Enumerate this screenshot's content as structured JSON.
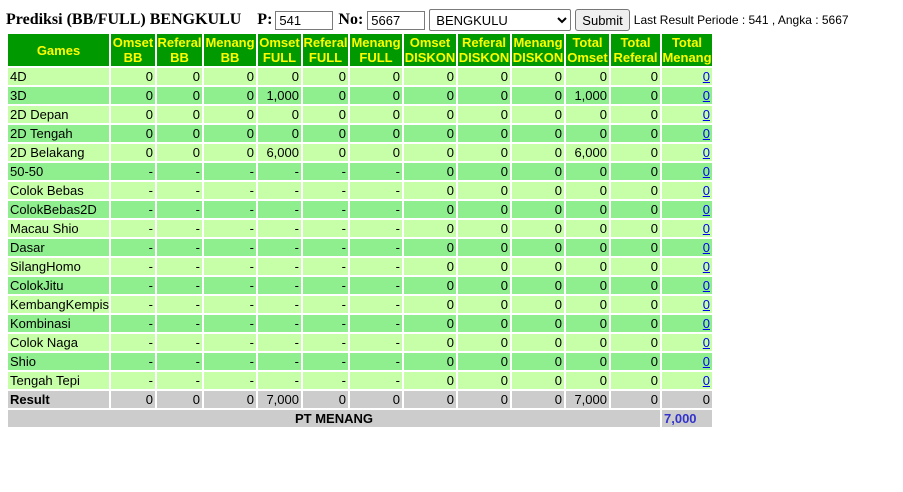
{
  "header": {
    "title": "Prediksi (BB/FULL) BENGKULU",
    "p_label": "P:",
    "p_value": "541",
    "no_label": "No:",
    "no_value": "5667",
    "market_selected": "BENGKULU",
    "submit_label": "Submit",
    "last_result": "Last Result Periode : 541 , Angka : 5667"
  },
  "table": {
    "headers": [
      [
        "Games"
      ],
      [
        "Omset",
        "BB"
      ],
      [
        "Referal",
        "BB"
      ],
      [
        "Menang",
        "BB"
      ],
      [
        "Omset",
        "FULL"
      ],
      [
        "Referal",
        "FULL"
      ],
      [
        "Menang",
        "FULL"
      ],
      [
        "Omset",
        "DISKON"
      ],
      [
        "Referal",
        "DISKON"
      ],
      [
        "Menang",
        "DISKON"
      ],
      [
        "Total",
        "Omset"
      ],
      [
        "Total",
        "Referal"
      ],
      [
        "Total",
        "Menang"
      ]
    ],
    "rows": [
      [
        "4D",
        "0",
        "0",
        "0",
        "0",
        "0",
        "0",
        "0",
        "0",
        "0",
        "0",
        "0",
        "0"
      ],
      [
        "3D",
        "0",
        "0",
        "0",
        "1,000",
        "0",
        "0",
        "0",
        "0",
        "0",
        "1,000",
        "0",
        "0"
      ],
      [
        "2D Depan",
        "0",
        "0",
        "0",
        "0",
        "0",
        "0",
        "0",
        "0",
        "0",
        "0",
        "0",
        "0"
      ],
      [
        "2D Tengah",
        "0",
        "0",
        "0",
        "0",
        "0",
        "0",
        "0",
        "0",
        "0",
        "0",
        "0",
        "0"
      ],
      [
        "2D Belakang",
        "0",
        "0",
        "0",
        "6,000",
        "0",
        "0",
        "0",
        "0",
        "0",
        "6,000",
        "0",
        "0"
      ],
      [
        "50-50",
        "-",
        "-",
        "-",
        "-",
        "-",
        "-",
        "0",
        "0",
        "0",
        "0",
        "0",
        "0"
      ],
      [
        "Colok Bebas",
        "-",
        "-",
        "-",
        "-",
        "-",
        "-",
        "0",
        "0",
        "0",
        "0",
        "0",
        "0"
      ],
      [
        "ColokBebas2D",
        "-",
        "-",
        "-",
        "-",
        "-",
        "-",
        "0",
        "0",
        "0",
        "0",
        "0",
        "0"
      ],
      [
        "Macau Shio",
        "-",
        "-",
        "-",
        "-",
        "-",
        "-",
        "0",
        "0",
        "0",
        "0",
        "0",
        "0"
      ],
      [
        "Dasar",
        "-",
        "-",
        "-",
        "-",
        "-",
        "-",
        "0",
        "0",
        "0",
        "0",
        "0",
        "0"
      ],
      [
        "SilangHomo",
        "-",
        "-",
        "-",
        "-",
        "-",
        "-",
        "0",
        "0",
        "0",
        "0",
        "0",
        "0"
      ],
      [
        "ColokJitu",
        "-",
        "-",
        "-",
        "-",
        "-",
        "-",
        "0",
        "0",
        "0",
        "0",
        "0",
        "0"
      ],
      [
        "KembangKempis",
        "-",
        "-",
        "-",
        "-",
        "-",
        "-",
        "0",
        "0",
        "0",
        "0",
        "0",
        "0"
      ],
      [
        "Kombinasi",
        "-",
        "-",
        "-",
        "-",
        "-",
        "-",
        "0",
        "0",
        "0",
        "0",
        "0",
        "0"
      ],
      [
        "Colok Naga",
        "-",
        "-",
        "-",
        "-",
        "-",
        "-",
        "0",
        "0",
        "0",
        "0",
        "0",
        "0"
      ],
      [
        "Shio",
        "-",
        "-",
        "-",
        "-",
        "-",
        "-",
        "0",
        "0",
        "0",
        "0",
        "0",
        "0"
      ],
      [
        "Tengah Tepi",
        "-",
        "-",
        "-",
        "-",
        "-",
        "-",
        "0",
        "0",
        "0",
        "0",
        "0",
        "0"
      ]
    ],
    "result": [
      "Result",
      "0",
      "0",
      "0",
      "7,000",
      "0",
      "0",
      "0",
      "0",
      "0",
      "7,000",
      "0",
      "0"
    ],
    "pt_label": "PT MENANG",
    "pt_value": "7,000"
  },
  "colors": {
    "header_bg": "#009900",
    "header_text": "#ffff00",
    "row_light": "#c6ffa8",
    "row_dark": "#8fef8f",
    "footer_bg": "#cccccc",
    "link": "#0000ee",
    "pt_value": "#3333cc"
  }
}
